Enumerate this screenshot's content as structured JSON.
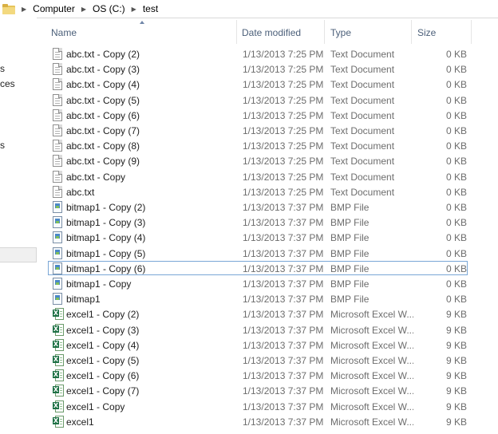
{
  "breadcrumb": [
    "Computer",
    "OS (C:)",
    "test"
  ],
  "nav_fragments": [
    "s",
    "ces",
    "s"
  ],
  "columns": {
    "name": "Name",
    "date": "Date modified",
    "type": "Type",
    "size": "Size"
  },
  "files": [
    {
      "name": "abc.txt - Copy (2)",
      "date": "1/13/2013 7:25 PM",
      "type": "Text Document",
      "size": "0 KB",
      "icon": "text-file-icon"
    },
    {
      "name": "abc.txt - Copy (3)",
      "date": "1/13/2013 7:25 PM",
      "type": "Text Document",
      "size": "0 KB",
      "icon": "text-file-icon"
    },
    {
      "name": "abc.txt - Copy (4)",
      "date": "1/13/2013 7:25 PM",
      "type": "Text Document",
      "size": "0 KB",
      "icon": "text-file-icon"
    },
    {
      "name": "abc.txt - Copy (5)",
      "date": "1/13/2013 7:25 PM",
      "type": "Text Document",
      "size": "0 KB",
      "icon": "text-file-icon"
    },
    {
      "name": "abc.txt - Copy (6)",
      "date": "1/13/2013 7:25 PM",
      "type": "Text Document",
      "size": "0 KB",
      "icon": "text-file-icon"
    },
    {
      "name": "abc.txt - Copy (7)",
      "date": "1/13/2013 7:25 PM",
      "type": "Text Document",
      "size": "0 KB",
      "icon": "text-file-icon"
    },
    {
      "name": "abc.txt - Copy (8)",
      "date": "1/13/2013 7:25 PM",
      "type": "Text Document",
      "size": "0 KB",
      "icon": "text-file-icon"
    },
    {
      "name": "abc.txt - Copy (9)",
      "date": "1/13/2013 7:25 PM",
      "type": "Text Document",
      "size": "0 KB",
      "icon": "text-file-icon"
    },
    {
      "name": "abc.txt - Copy",
      "date": "1/13/2013 7:25 PM",
      "type": "Text Document",
      "size": "0 KB",
      "icon": "text-file-icon"
    },
    {
      "name": "abc.txt",
      "date": "1/13/2013 7:25 PM",
      "type": "Text Document",
      "size": "0 KB",
      "icon": "text-file-icon"
    },
    {
      "name": "bitmap1 - Copy (2)",
      "date": "1/13/2013 7:37 PM",
      "type": "BMP File",
      "size": "0 KB",
      "icon": "bitmap-file-icon"
    },
    {
      "name": "bitmap1 - Copy (3)",
      "date": "1/13/2013 7:37 PM",
      "type": "BMP File",
      "size": "0 KB",
      "icon": "bitmap-file-icon"
    },
    {
      "name": "bitmap1 - Copy (4)",
      "date": "1/13/2013 7:37 PM",
      "type": "BMP File",
      "size": "0 KB",
      "icon": "bitmap-file-icon"
    },
    {
      "name": "bitmap1 - Copy (5)",
      "date": "1/13/2013 7:37 PM",
      "type": "BMP File",
      "size": "0 KB",
      "icon": "bitmap-file-icon"
    },
    {
      "name": "bitmap1 - Copy (6)",
      "date": "1/13/2013 7:37 PM",
      "type": "BMP File",
      "size": "0 KB",
      "icon": "bitmap-file-icon",
      "selected": true
    },
    {
      "name": "bitmap1 - Copy",
      "date": "1/13/2013 7:37 PM",
      "type": "BMP File",
      "size": "0 KB",
      "icon": "bitmap-file-icon"
    },
    {
      "name": "bitmap1",
      "date": "1/13/2013 7:37 PM",
      "type": "BMP File",
      "size": "0 KB",
      "icon": "bitmap-file-icon"
    },
    {
      "name": "excel1 - Copy (2)",
      "date": "1/13/2013 7:37 PM",
      "type": "Microsoft Excel W...",
      "size": "9 KB",
      "icon": "excel-file-icon"
    },
    {
      "name": "excel1 - Copy (3)",
      "date": "1/13/2013 7:37 PM",
      "type": "Microsoft Excel W...",
      "size": "9 KB",
      "icon": "excel-file-icon"
    },
    {
      "name": "excel1 - Copy (4)",
      "date": "1/13/2013 7:37 PM",
      "type": "Microsoft Excel W...",
      "size": "9 KB",
      "icon": "excel-file-icon"
    },
    {
      "name": "excel1 - Copy (5)",
      "date": "1/13/2013 7:37 PM",
      "type": "Microsoft Excel W...",
      "size": "9 KB",
      "icon": "excel-file-icon"
    },
    {
      "name": "excel1 - Copy (6)",
      "date": "1/13/2013 7:37 PM",
      "type": "Microsoft Excel W...",
      "size": "9 KB",
      "icon": "excel-file-icon"
    },
    {
      "name": "excel1 - Copy (7)",
      "date": "1/13/2013 7:37 PM",
      "type": "Microsoft Excel W...",
      "size": "9 KB",
      "icon": "excel-file-icon"
    },
    {
      "name": "excel1 - Copy",
      "date": "1/13/2013 7:37 PM",
      "type": "Microsoft Excel W...",
      "size": "9 KB",
      "icon": "excel-file-icon"
    },
    {
      "name": "excel1",
      "date": "1/13/2013 7:37 PM",
      "type": "Microsoft Excel W...",
      "size": "9 KB",
      "icon": "excel-file-icon"
    }
  ],
  "colors": {
    "header_text": "#4c607a",
    "selection_border": "#7aa7d6",
    "muted_text": "#6d6d6d"
  }
}
